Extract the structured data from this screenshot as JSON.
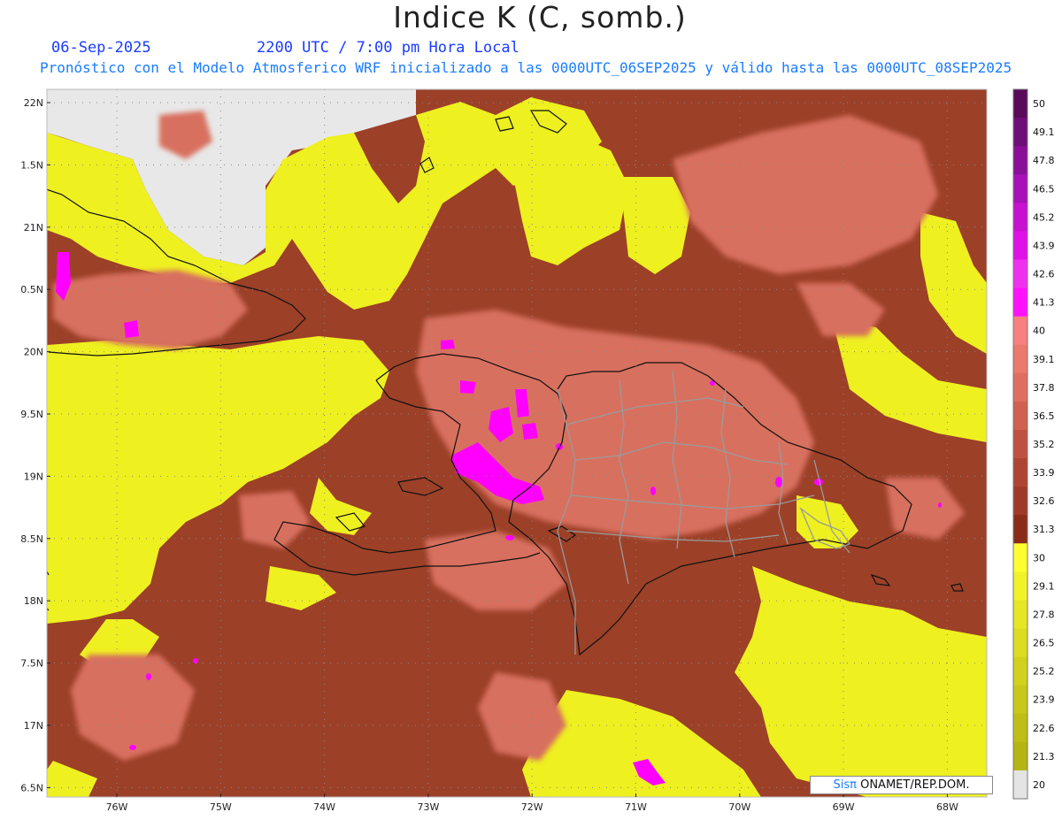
{
  "header": {
    "title": "Indice K (C, somb.)",
    "date": "06-Sep-2025",
    "time": "2200 UTC / 7:00 pm Hora Local",
    "subtitle": "Pronóstico con el Modelo Atmosferico WRF inicializado a las 0000UTC_06SEP2025 y válido hasta las  0000UTC_08SEP2025"
  },
  "map": {
    "lat_labels": [
      "22N",
      "1.5N",
      "21N",
      "0.5N",
      "20N",
      "9.5N",
      "19N",
      "8.5N",
      "18N",
      "7.5N",
      "17N",
      "6.5N"
    ],
    "lon_labels": [
      "76W",
      "75W",
      "74W",
      "73W",
      "72W",
      "71W",
      "70W",
      "69W",
      "68W"
    ],
    "colors": {
      "no_data": "#e8e8e8",
      "low_yellow": "#eef020",
      "mid_brown": "#9c4028",
      "high_salmon": "#d8705e",
      "max_magenta": "#ff00ff",
      "border_black": "#111111",
      "province_grey": "#9a9a9a"
    }
  },
  "colorbar": {
    "labels": [
      "50",
      "49.1",
      "47.8",
      "46.5",
      "45.2",
      "43.9",
      "42.6",
      "41.3",
      "40",
      "39.1",
      "37.8",
      "36.5",
      "35.2",
      "33.9",
      "32.6",
      "31.3",
      "30",
      "29.1",
      "27.8",
      "26.5",
      "25.2",
      "23.9",
      "22.6",
      "21.3",
      "20"
    ],
    "colors": [
      "#5a0a5a",
      "#6e0e78",
      "#8a0e98",
      "#a810b8",
      "#c810d0",
      "#e010e8",
      "#f030f0",
      "#ff10ff",
      "#f88080",
      "#ec7a6c",
      "#e06e60",
      "#d06050",
      "#c05040",
      "#b04432",
      "#a03a28",
      "#8a2c18",
      "#fefe30",
      "#f2f22a",
      "#e6e626",
      "#dcdc22",
      "#d2d21e",
      "#c8c81a",
      "#bebe16",
      "#b4b412",
      "#e4e4e4"
    ]
  },
  "credit": {
    "brand": "Sisπ",
    "text": " ONAMET/REP.DOM."
  }
}
